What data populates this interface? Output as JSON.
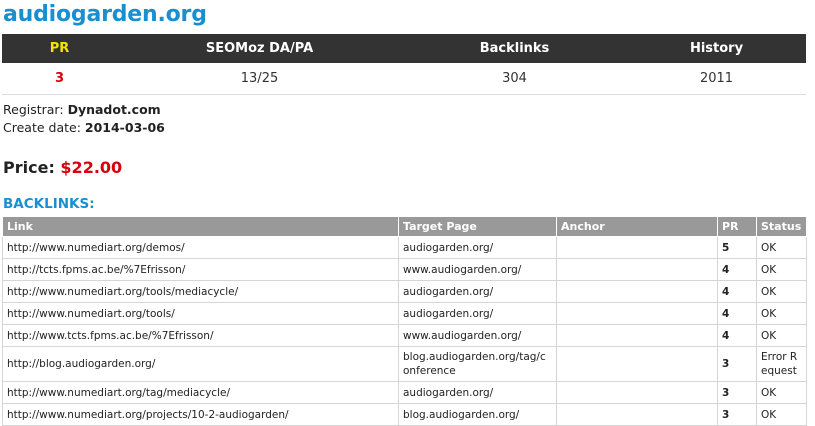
{
  "site": {
    "domain": "audiogarden.org"
  },
  "stats": {
    "headers": {
      "pr": "PR",
      "seomoz": "SEOMoz DA/PA",
      "backlinks": "Backlinks",
      "history": "History"
    },
    "values": {
      "pr": "3",
      "seomoz": "13/25",
      "backlinks": "304",
      "history": "2011"
    }
  },
  "registrar": {
    "label": "Registrar:",
    "value": "Dynadot.com"
  },
  "create_date": {
    "label": "Create date:",
    "value": "2014-03-06"
  },
  "price": {
    "label": "Price:",
    "value": "$22.00"
  },
  "backlinks_section": {
    "title": "BACKLINKS:",
    "headers": {
      "link": "Link",
      "target": "Target Page",
      "anchor": "Anchor",
      "pr": "PR",
      "status": "Status"
    },
    "rows": [
      {
        "link": "http://www.numediart.org/demos/",
        "target": "audiogarden.org/",
        "anchor": "",
        "pr": "5",
        "status": "OK"
      },
      {
        "link": "http://tcts.fpms.ac.be/%7Efrisson/",
        "target": "www.audiogarden.org/",
        "anchor": "",
        "pr": "4",
        "status": "OK"
      },
      {
        "link": "http://www.numediart.org/tools/mediacycle/",
        "target": "audiogarden.org/",
        "anchor": "",
        "pr": "4",
        "status": "OK"
      },
      {
        "link": "http://www.numediart.org/tools/",
        "target": "audiogarden.org/",
        "anchor": "",
        "pr": "4",
        "status": "OK"
      },
      {
        "link": "http://www.tcts.fpms.ac.be/%7Efrisson/",
        "target": "www.audiogarden.org/",
        "anchor": "",
        "pr": "4",
        "status": "OK"
      },
      {
        "link": "http://blog.audiogarden.org/",
        "target": "blog.audiogarden.org/tag/conference",
        "anchor": "",
        "pr": "3",
        "status": "Error Request"
      },
      {
        "link": "http://www.numediart.org/tag/mediacycle/",
        "target": "audiogarden.org/",
        "anchor": "",
        "pr": "3",
        "status": "OK"
      },
      {
        "link": "http://www.numediart.org/projects/10-2-audiogarden/",
        "target": "blog.audiogarden.org/",
        "anchor": "",
        "pr": "3",
        "status": "OK"
      }
    ]
  },
  "colors": {
    "title_blue": "#1a8fd0",
    "price_red": "#d8000c",
    "header_dark": "#333333",
    "pr_yellow": "#f5e300"
  }
}
